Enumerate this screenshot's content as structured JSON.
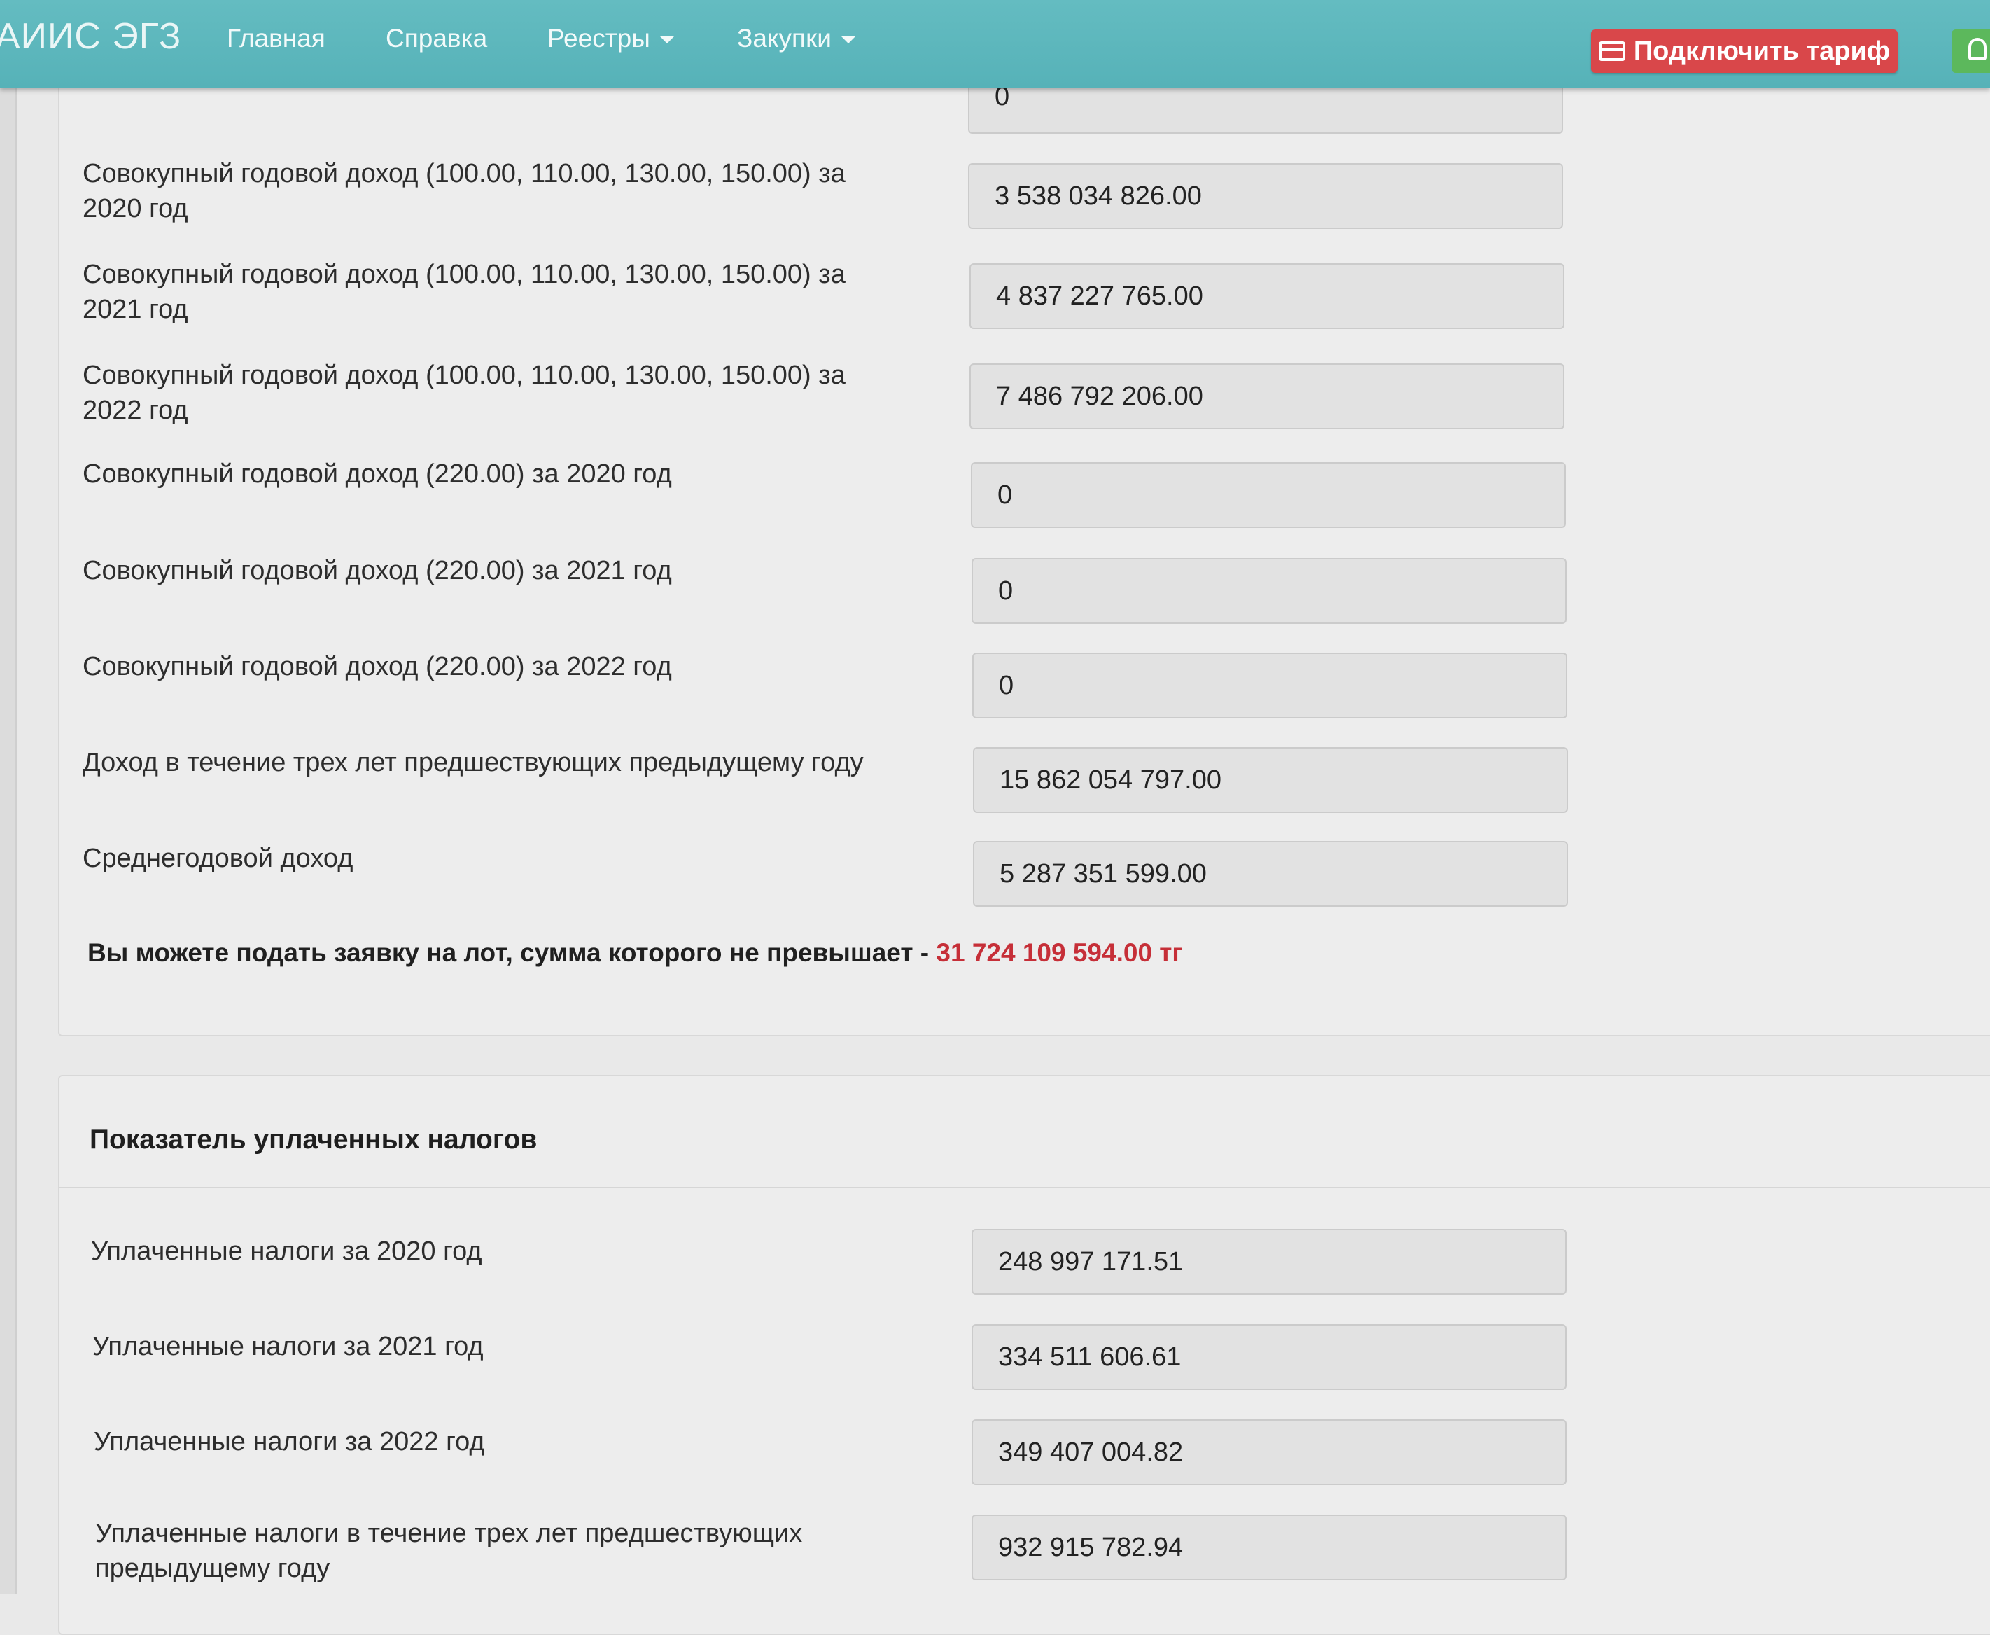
{
  "navbar": {
    "brand": "АИИС ЭГЗ",
    "items": [
      {
        "label": "Главная"
      },
      {
        "label": "Справка"
      },
      {
        "label": "Реестры"
      },
      {
        "label": "Закупки"
      }
    ],
    "tariff_button": "Подключить тариф"
  },
  "income": {
    "top_partial_value": "0",
    "rows": [
      {
        "label": "Совокупный годовой доход (100.00, 110.00, 130.00, 150.00) за 2020 год",
        "value": "3 538 034 826.00"
      },
      {
        "label": "Совокупный годовой доход (100.00, 110.00, 130.00, 150.00) за 2021 год",
        "value": "4 837 227 765.00"
      },
      {
        "label": "Совокупный годовой доход (100.00, 110.00, 130.00, 150.00) за 2022 год",
        "value": "7 486 792 206.00"
      },
      {
        "label": "Совокупный годовой доход (220.00) за 2020 год",
        "value": "0"
      },
      {
        "label": "Совокупный годовой доход (220.00) за 2021 год",
        "value": "0"
      },
      {
        "label": "Совокупный годовой доход (220.00) за 2022 год",
        "value": "0"
      },
      {
        "label": "Доход в течение трех лет предшествующих предыдущему году",
        "value": "15 862 054 797.00"
      },
      {
        "label": "Среднегодовой доход",
        "value": "5 287 351 599.00"
      }
    ],
    "notice_text": "Вы можете подать заявку на лот, сумма которого не превышает -",
    "notice_amount": "31 724 109 594.00 тг"
  },
  "taxes": {
    "title": "Показатель уплаченных налогов",
    "rows": [
      {
        "label": "Уплаченные налоги за 2020 год",
        "value": "248 997 171.51"
      },
      {
        "label": "Уплаченные налоги за 2021 год",
        "value": "334 511 606.61"
      },
      {
        "label": "Уплаченные налоги за 2022 год",
        "value": "349 407 004.82"
      },
      {
        "label": "Уплаченные налоги в течение трех лет предшествующих предыдущему году",
        "value": "932 915 782.94"
      }
    ]
  },
  "colors": {
    "navbar": "#5cb6bb",
    "tariff_button": "#d9474a",
    "amount_highlight": "#c62f38"
  }
}
